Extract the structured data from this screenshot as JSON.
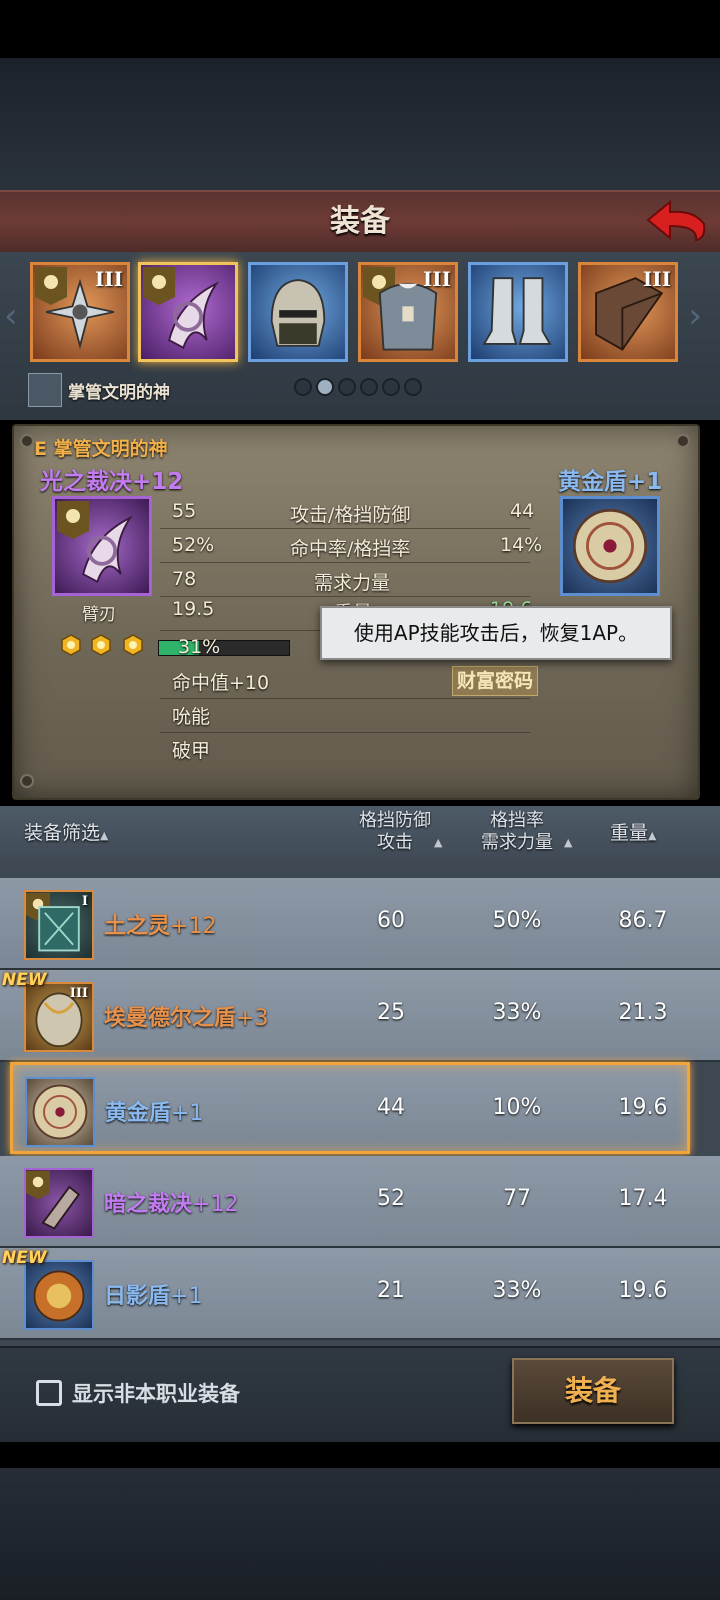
{
  "header": {
    "title": "装备",
    "back_icon": "back-arrow-icon"
  },
  "equip_slots": [
    {
      "name": "weapon-slot",
      "tier": "III",
      "frame": "orange"
    },
    {
      "name": "arm-blade-slot",
      "tier": "",
      "frame": "purple",
      "selected": true
    },
    {
      "name": "helmet-slot",
      "tier": "",
      "frame": "blue"
    },
    {
      "name": "armor-slot",
      "tier": "III",
      "frame": "orange"
    },
    {
      "name": "boots-slot",
      "tier": "",
      "frame": "blue"
    },
    {
      "name": "book-slot",
      "tier": "III",
      "frame": "orange"
    }
  ],
  "tier_labels": {
    "s0": "III",
    "s3": "III",
    "s5": "III"
  },
  "set": {
    "name": "掌管文明的神"
  },
  "pager": {
    "count": 6,
    "active": 1
  },
  "compare": {
    "set_label": "E 掌管文明的神",
    "left_item": {
      "name": "光之裁决+12",
      "type": "臂刃"
    },
    "right_item": {
      "name": "黄金盾+1"
    },
    "rows": [
      {
        "left": "55",
        "label": "攻击/格挡防御",
        "right": "44"
      },
      {
        "left": "52%",
        "label": "命中率/格挡率",
        "right": "14%"
      },
      {
        "left": "78",
        "label": "需求力量",
        "right": ""
      },
      {
        "left": "19.5",
        "label": "重量",
        "right": "19.6"
      }
    ],
    "durability": {
      "percent": "31%",
      "value": 0.31
    },
    "stars": 3,
    "effects": [
      "命中值+10",
      "吮能",
      "破甲"
    ],
    "right_effect": "财富密码",
    "tooltip": "使用AP技能攻击后，恢复1AP。"
  },
  "list": {
    "headers": {
      "filter": "装备筛选",
      "col1a": "格挡防御",
      "col1b": "攻击",
      "col2a": "格挡率",
      "col2b": "需求力量",
      "col3": "重量"
    },
    "rows": [
      {
        "name": "土之灵",
        "plus": "+12",
        "color": "#e8914a",
        "tier": "I",
        "v1": "60",
        "v2": "50%",
        "v3": "86.7",
        "new": false,
        "sel": false
      },
      {
        "name": "埃曼德尔之盾",
        "plus": "+3",
        "color": "#e8914a",
        "tier": "III",
        "v1": "25",
        "v2": "33%",
        "v3": "21.3",
        "new": true,
        "sel": false
      },
      {
        "name": "黄金盾",
        "plus": "+1",
        "color": "#8ab9f0",
        "tier": "",
        "v1": "44",
        "v2": "10%",
        "v3": "19.6",
        "new": false,
        "sel": true
      },
      {
        "name": "暗之裁决",
        "plus": "+12",
        "color": "#c27bf0",
        "tier": "",
        "v1": "52",
        "v2": "77",
        "v3": "17.4",
        "new": false,
        "sel": false
      },
      {
        "name": "日影盾",
        "plus": "+1",
        "color": "#8ab9f0",
        "tier": "",
        "v1": "21",
        "v2": "33%",
        "v3": "19.6",
        "new": true,
        "sel": false
      }
    ],
    "new_label": "NEW"
  },
  "footer": {
    "checkbox_label": "显示非本职业装备",
    "equip_button": "装备"
  },
  "colors": {
    "accent": "#f0a43a",
    "purple_rarity": "#c27bf0",
    "blue_rarity": "#8ab9f0",
    "orange_rarity": "#e8914a"
  }
}
